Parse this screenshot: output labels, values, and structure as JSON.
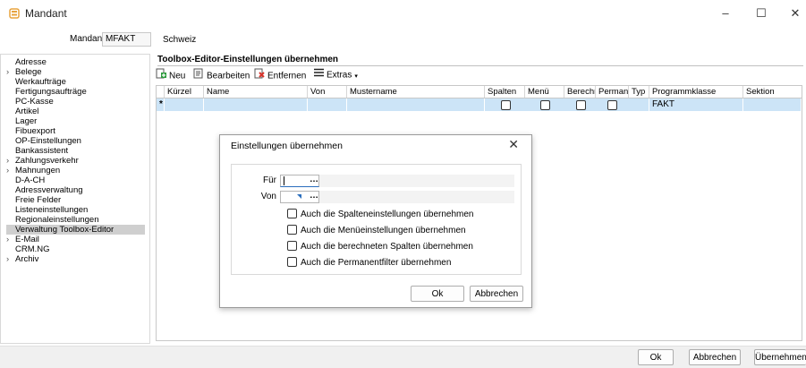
{
  "window": {
    "title": "Mandant",
    "controls": [
      "–",
      "☐",
      "✕"
    ]
  },
  "header": {
    "mandant_label": "Mandant",
    "mandant_value": "MFAKT",
    "country": "Schweiz"
  },
  "sidebar": {
    "items": [
      {
        "label": "Adresse",
        "expandable": false
      },
      {
        "label": "Belege",
        "expandable": true
      },
      {
        "label": "Werkaufträge",
        "expandable": false
      },
      {
        "label": "Fertigungsaufträge",
        "expandable": false
      },
      {
        "label": "PC-Kasse",
        "expandable": false
      },
      {
        "label": "Artikel",
        "expandable": false
      },
      {
        "label": "Lager",
        "expandable": false
      },
      {
        "label": "Fibuexport",
        "expandable": false
      },
      {
        "label": "OP-Einstellungen",
        "expandable": false
      },
      {
        "label": "Bankassistent",
        "expandable": false
      },
      {
        "label": "Zahlungsverkehr",
        "expandable": true
      },
      {
        "label": "Mahnungen",
        "expandable": true
      },
      {
        "label": "D-A-CH",
        "expandable": false
      },
      {
        "label": "Adressverwaltung",
        "expandable": false
      },
      {
        "label": "Freie Felder",
        "expandable": false
      },
      {
        "label": "Listeneinstellungen",
        "expandable": false
      },
      {
        "label": "Regionaleinstellungen",
        "expandable": false
      },
      {
        "label": "Verwaltung Toolbox-Editor",
        "expandable": false,
        "selected": true
      },
      {
        "label": "E-Mail",
        "expandable": true
      },
      {
        "label": "CRM.NG",
        "expandable": false
      },
      {
        "label": "Archiv",
        "expandable": true
      }
    ]
  },
  "main": {
    "section_title": "Toolbox-Editor-Einstellungen übernehmen",
    "toolbar": {
      "new": "Neu",
      "edit": "Bearbeiten",
      "remove": "Entfernen",
      "extras": "Extras"
    },
    "columns": [
      "Kürzel",
      "Name",
      "Von",
      "Mustername",
      "Spalten",
      "Menü",
      "Berechn",
      "Permane",
      "Typ",
      "Programmklasse",
      "Sektion"
    ],
    "row": {
      "marker": "*",
      "programmklasse": "FAKT"
    }
  },
  "dialog": {
    "title": "Einstellungen übernehmen",
    "fuer_label": "Für",
    "von_label": "Von",
    "checkboxes": [
      "Auch die Spalteneinstellungen übernehmen",
      "Auch die Menüeinstellungen übernehmen",
      "Auch die berechneten Spalten übernehmen",
      "Auch die Permanentfilter übernehmen"
    ],
    "ok": "Ok",
    "cancel": "Abbrechen"
  },
  "footer": {
    "ok": "Ok",
    "cancel": "Abbrechen",
    "apply": "Übernehmen"
  },
  "colors": {
    "selection": "#cce4f7",
    "tree_selected": "#cfcfcf",
    "accent_icon": "#e8a33d"
  }
}
